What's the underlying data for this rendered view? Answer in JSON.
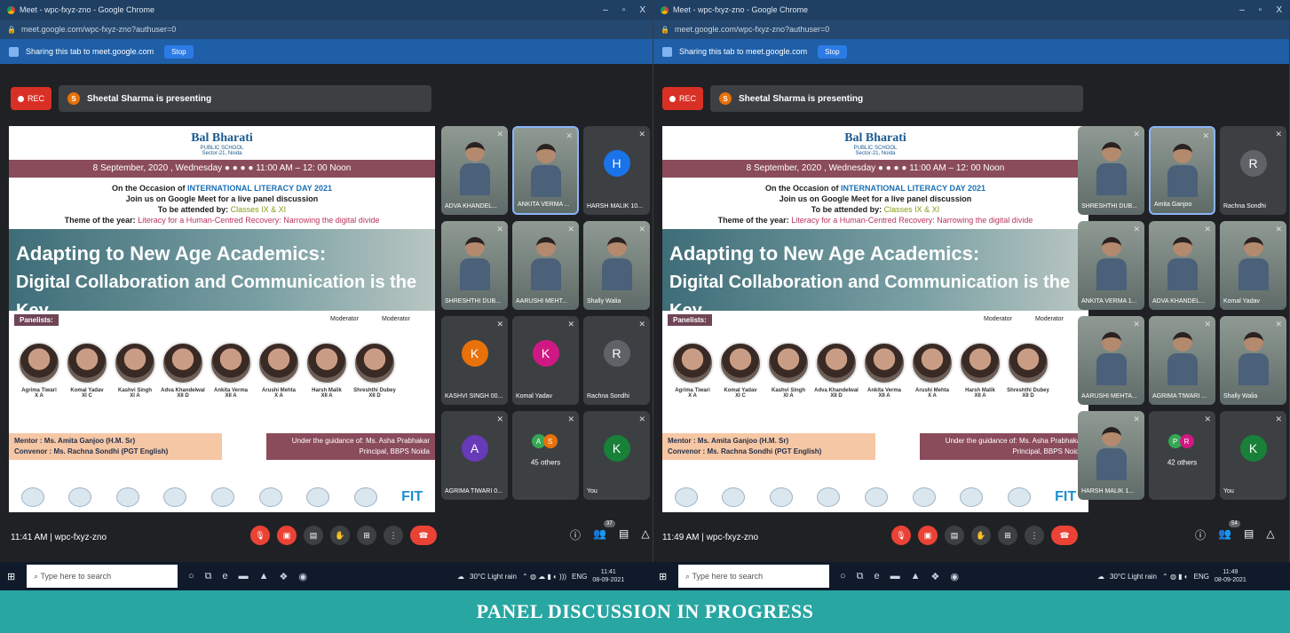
{
  "bottom_banner": "PANEL DISCUSSION IN PROGRESS",
  "windows": [
    {
      "title": "Meet - wpc-fxyz-zno - Google Chrome",
      "url": "meet.google.com/wpc-fxyz-zno?authuser=0",
      "sharing_text": "Sharing this tab to meet.google.com",
      "stop_label": "Stop",
      "rec_label": "REC",
      "presenting_text": "Sheetal Sharma is presenting",
      "presenter_initial": "S",
      "meeting_time": "11:41 AM",
      "meeting_code": "wpc-fxyz-zno",
      "participant_count": "37",
      "tiles": [
        {
          "name": "ADVA KHANDEL...",
          "kind": "video"
        },
        {
          "name": "ANKITA VERMA ...",
          "kind": "video"
        },
        {
          "name": "HARSH MALIK 10...",
          "kind": "avatar",
          "initial": "H",
          "color": "#1a73e8"
        },
        {
          "name": "SHRESHTHI DUB...",
          "kind": "video"
        },
        {
          "name": "AARUSHI MEHT...",
          "kind": "video"
        },
        {
          "name": "Shally Walia",
          "kind": "video"
        },
        {
          "name": "KASHVI SINGH 00...",
          "kind": "avatar",
          "initial": "K",
          "color": "#e8710a"
        },
        {
          "name": "Komal Yadav",
          "kind": "avatar",
          "initial": "K",
          "color": "#d01884"
        },
        {
          "name": "Rachna Sondhi",
          "kind": "avatar",
          "initial": "R",
          "color": "#5f6368"
        },
        {
          "name": "AGRIMA TIWARI 0...",
          "kind": "avatar",
          "initial": "A",
          "color": "#673ab7"
        },
        {
          "name": "",
          "kind": "others",
          "others": "45 others",
          "i1": "A",
          "i2": "S",
          "c1": "#34a853",
          "c2": "#e8710a"
        },
        {
          "name": "You",
          "kind": "avatar",
          "initial": "K",
          "color": "#188038"
        }
      ]
    },
    {
      "title": "Meet - wpc-fxyz-zno - Google Chrome",
      "url": "meet.google.com/wpc-fxyz-zno?authuser=0",
      "sharing_text": "Sharing this tab to meet.google.com",
      "stop_label": "Stop",
      "rec_label": "REC",
      "presenting_text": "Sheetal Sharma is presenting",
      "presenter_initial": "S",
      "meeting_time": "11:49 AM",
      "meeting_code": "wpc-fxyz-zno",
      "participant_count": "54",
      "tiles": [
        {
          "name": "SHRESHTHI DUB...",
          "kind": "video"
        },
        {
          "name": "Amita Ganjoo",
          "kind": "video"
        },
        {
          "name": "Rachna Sondhi",
          "kind": "avatar",
          "initial": "R",
          "color": "#5f6368"
        },
        {
          "name": "ANKITA VERMA 1...",
          "kind": "video"
        },
        {
          "name": "ADVA KHANDEL...",
          "kind": "video"
        },
        {
          "name": "Komal Yadav",
          "kind": "video"
        },
        {
          "name": "AARUSHI MEHTA...",
          "kind": "video"
        },
        {
          "name": "AGRIMA TIWARI ...",
          "kind": "video"
        },
        {
          "name": "Shally Walia",
          "kind": "video"
        },
        {
          "name": "HARSH MALIK 1...",
          "kind": "video"
        },
        {
          "name": "",
          "kind": "others",
          "others": "42 others",
          "i1": "P",
          "i2": "R",
          "c1": "#34a853",
          "c2": "#d01884"
        },
        {
          "name": "You",
          "kind": "avatar",
          "initial": "K",
          "color": "#188038"
        }
      ]
    }
  ],
  "slide": {
    "school_name": "Bal Bharati",
    "school_sub": "PUBLIC SCHOOL",
    "school_loc": "Sector-21, Noida",
    "date_line": "8 September, 2020 , Wednesday ● ● ● ● 11:00 AM – 12: 00 Noon",
    "occasion_prefix": "On the Occasion of",
    "occasion_event": "INTERNATIONAL LITERACY DAY 2021",
    "join_line": "Join us on Google Meet for a live panel discussion",
    "attend_prefix": "To be attended by:",
    "attend_classes": "Classes IX & XI",
    "theme_prefix": "Theme of the year:",
    "theme_text": "Literacy for a Human-Centred Recovery: Narrowing the digital divide",
    "headline1": "Adapting to New Age Academics:",
    "headline2": "Digital Collaboration and Communication is the Key",
    "panelists_label": "Panelists:",
    "moderator_label": "Moderator",
    "panelists": [
      {
        "name": "Agrima Tiwari",
        "cls": "X A"
      },
      {
        "name": "Komal Yadav",
        "cls": "XI C"
      },
      {
        "name": "Kashvi Singh",
        "cls": "XI A"
      },
      {
        "name": "Adva Khandelwal",
        "cls": "XII D"
      },
      {
        "name": "Ankita Verma",
        "cls": "XII A"
      },
      {
        "name": "Arushi Mehta",
        "cls": "X A"
      },
      {
        "name": "Harsh Malik",
        "cls": "XII A"
      },
      {
        "name": "Shreshthi Dubey",
        "cls": "XII D"
      }
    ],
    "mentor_line": "Mentor      : Ms. Amita Ganjoo (H.M. Sr)",
    "convenor_line": "Convenor  : Ms. Rachna Sondhi (PGT English)",
    "guidance_line": "Under the guidance of: Ms. Asha Prabhakar",
    "principal_line": "Principal, BBPS Noida",
    "fit_text": "FIT"
  },
  "taskbar": {
    "search_placeholder": "Type here to search",
    "weather": "30°C Light rain",
    "lang": "ENG",
    "date": "08-09-2021",
    "times": [
      "11:41",
      "11:49"
    ]
  }
}
